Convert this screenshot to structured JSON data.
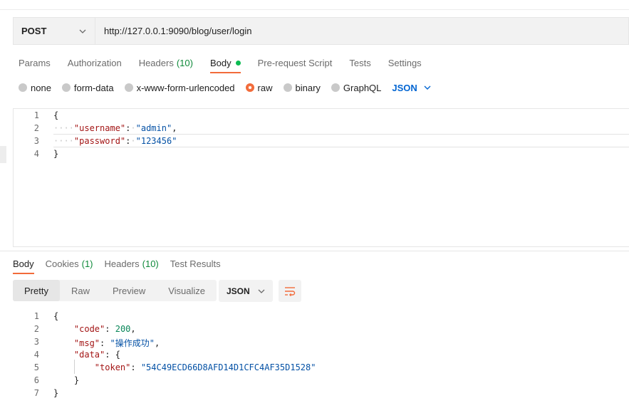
{
  "request": {
    "method": "POST",
    "url": "http://127.0.0.1:9090/blog/user/login"
  },
  "request_tabs": [
    {
      "label": "Params"
    },
    {
      "label": "Authorization"
    },
    {
      "label": "Headers",
      "count": "(10)"
    },
    {
      "label": "Body",
      "active": true
    },
    {
      "label": "Pre-request Script"
    },
    {
      "label": "Tests"
    },
    {
      "label": "Settings"
    }
  ],
  "body_types": [
    "none",
    "form-data",
    "x-www-form-urlencoded",
    "raw",
    "binary",
    "GraphQL"
  ],
  "body_type_selected": "raw",
  "body_format": "JSON",
  "request_body_lines": [
    {
      "n": "1",
      "text": "{"
    },
    {
      "n": "2",
      "key": "\"username\"",
      "value": "\"admin\"",
      "trail": ","
    },
    {
      "n": "3",
      "key": "\"password\"",
      "value": "\"123456\""
    },
    {
      "n": "4",
      "text": "}"
    }
  ],
  "response_tabs": [
    {
      "label": "Body",
      "active": true
    },
    {
      "label": "Cookies",
      "count": "(1)"
    },
    {
      "label": "Headers",
      "count": "(10)"
    },
    {
      "label": "Test Results"
    }
  ],
  "view_modes": [
    "Pretty",
    "Raw",
    "Preview",
    "Visualize"
  ],
  "view_mode_selected": "Pretty",
  "response_format": "JSON",
  "response_body_lines": [
    {
      "n": "1",
      "text": "{"
    },
    {
      "n": "2",
      "key": "\"code\"",
      "value": "200",
      "trail": ","
    },
    {
      "n": "3",
      "key": "\"msg\"",
      "value": "\"操作成功\"",
      "trail": ","
    },
    {
      "n": "4",
      "key": "\"data\"",
      "text": "{"
    },
    {
      "n": "5",
      "key": "\"token\"",
      "value": "\"54C49ECD66D8AFD14D1CFC4AF35D1528\""
    },
    {
      "n": "6",
      "text": "}"
    },
    {
      "n": "7",
      "text": "}"
    }
  ],
  "colors": {
    "accent": "#f26b3a",
    "active_dot": "#0cbb52",
    "link_blue": "#0265d2",
    "json_key": "#a31515",
    "json_string": "#0451a5",
    "json_number": "#098658"
  },
  "icons": [
    "chevron-down-icon",
    "wrap-lines-icon"
  ]
}
